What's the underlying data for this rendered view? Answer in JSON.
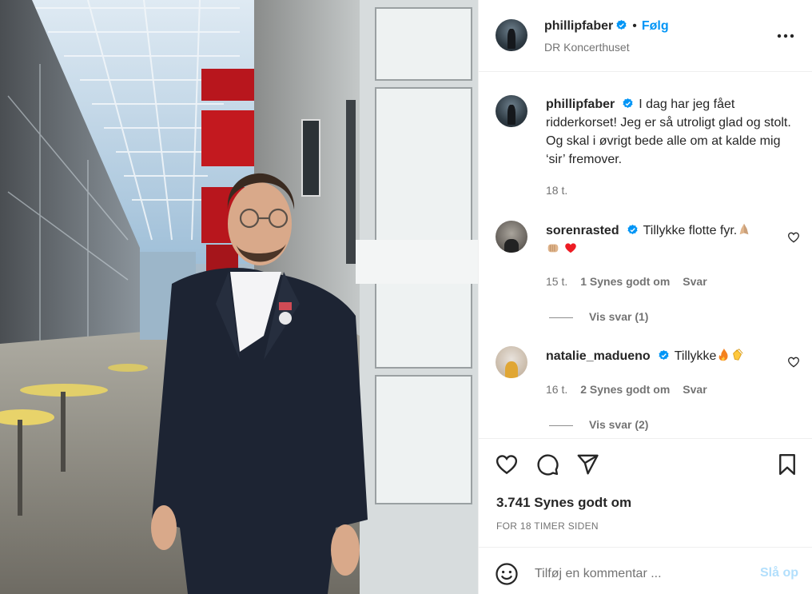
{
  "colors": {
    "accent": "#0095f6",
    "accent_disabled": "#b2dffc",
    "verified": "#0095f6",
    "muted_text": "#737373",
    "divider": "#efefef",
    "red_heart": "#ed1c24"
  },
  "post": {
    "author": "phillipfaber",
    "follow_label": "Følg",
    "separator": "•",
    "location": "DR Koncerthuset",
    "more_icon": "more-horizontal-icon"
  },
  "caption": {
    "username": "phillipfaber",
    "text": "I dag har jeg fået ridderkorset! Jeg er så utroligt glad og stolt. Og skal i øvrigt bede alle om at kalde mig ‘sir’ fremover.",
    "time": "18 t."
  },
  "comments": [
    {
      "username": "sorenrasted",
      "text": "Tillykke flotte fyr.",
      "emojis": [
        "folded-hands-emoji",
        "fist-emoji",
        "red-heart-emoji"
      ],
      "time": "15 t.",
      "likes": "1 Synes godt om",
      "reply_label": "Svar",
      "view_replies": "Vis svar (1)"
    },
    {
      "username": "natalie_madueno",
      "text": "Tillykke",
      "emojis": [
        "fire-emoji",
        "clapping-hands-emoji"
      ],
      "time": "16 t.",
      "likes": "2 Synes godt om",
      "reply_label": "Svar",
      "view_replies": "Vis svar (2)"
    }
  ],
  "actions": {
    "icons": [
      "heart-icon",
      "comment-icon",
      "share-icon",
      "bookmark-icon"
    ],
    "likes_text": "3.741 Synes godt om",
    "posted_time": "FOR 18 TIMER SIDEN"
  },
  "composer": {
    "emoji_icon": "smiley-icon",
    "placeholder": "Tilføj en kommentar ...",
    "post_label": "Slå op"
  }
}
